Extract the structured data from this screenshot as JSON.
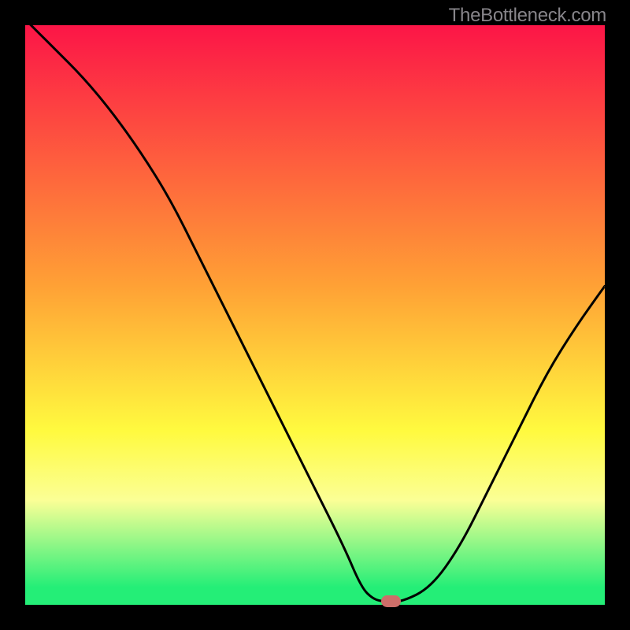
{
  "watermark": "TheBottleneck.com",
  "colors": {
    "black": "#000000",
    "curve": "#000000",
    "marker": "#cd6e69",
    "grad_top": "#fc1547",
    "grad_mid1": "#ffa436",
    "grad_mid2": "#fffa3f",
    "grad_low": "#fbff96",
    "grad_green": "#24ee77"
  },
  "chart_data": {
    "type": "line",
    "title": "",
    "xlabel": "",
    "ylabel": "",
    "xlim": [
      0,
      100
    ],
    "ylim": [
      0,
      100
    ],
    "series": [
      {
        "name": "bottleneck-curve",
        "x": [
          0,
          5,
          10,
          15,
          20,
          25,
          30,
          35,
          40,
          45,
          50,
          55,
          58,
          60,
          62,
          65,
          70,
          75,
          80,
          85,
          90,
          95,
          100
        ],
        "values": [
          101,
          96,
          91,
          85,
          78,
          70,
          60,
          50,
          40,
          30,
          20,
          10,
          3,
          1,
          0.5,
          0.5,
          3,
          10,
          20,
          30,
          40,
          48,
          55
        ]
      }
    ],
    "annotations": [
      {
        "name": "optimal-marker",
        "x": 63,
        "y": 0.5
      }
    ],
    "background_gradient": [
      {
        "stop": 0.0,
        "color": "#fc1547"
      },
      {
        "stop": 0.45,
        "color": "#ffa135"
      },
      {
        "stop": 0.7,
        "color": "#fffa3f"
      },
      {
        "stop": 0.82,
        "color": "#fbff96"
      },
      {
        "stop": 0.97,
        "color": "#24ee77"
      },
      {
        "stop": 1.0,
        "color": "#24ee77"
      }
    ]
  }
}
